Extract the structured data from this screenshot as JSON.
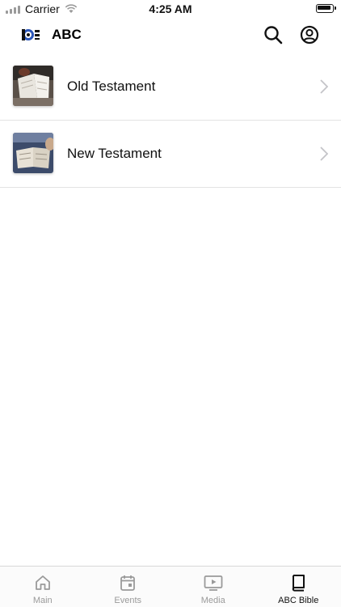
{
  "status_bar": {
    "carrier": "Carrier",
    "time": "4:25 AM"
  },
  "header": {
    "title": "ABC",
    "search_icon": "search-icon",
    "profile_icon": "profile-icon"
  },
  "list": {
    "items": [
      {
        "label": "Old Testament",
        "thumbnail": "open-bible-photo"
      },
      {
        "label": "New Testament",
        "thumbnail": "open-bible-photo"
      }
    ]
  },
  "tabbar": {
    "tabs": [
      {
        "label": "Main",
        "icon": "home-icon",
        "active": false
      },
      {
        "label": "Events",
        "icon": "calendar-icon",
        "active": false
      },
      {
        "label": "Media",
        "icon": "play-icon",
        "active": false
      },
      {
        "label": "ABC Bible",
        "icon": "book-icon",
        "active": true
      }
    ]
  },
  "colors": {
    "active": "#111111",
    "inactive": "#9a9a9a",
    "logo_blue": "#2b56b8"
  }
}
